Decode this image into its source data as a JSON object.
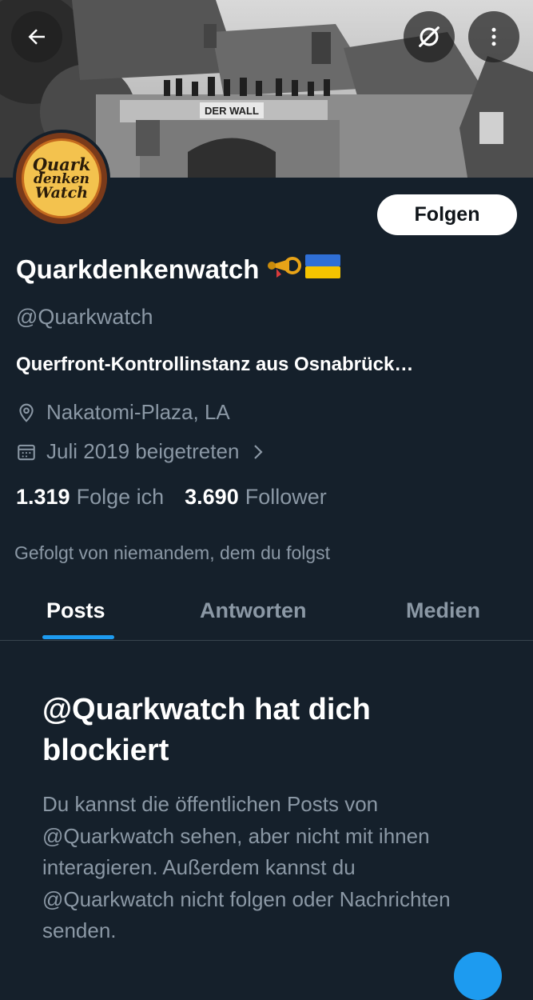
{
  "header": {
    "banner_signs": [
      "DER WALL"
    ],
    "back_icon": "arrow-left-icon",
    "hide_icon": "eye-slash-icon",
    "more_icon": "more-vertical-icon"
  },
  "avatar": {
    "lines": [
      "Quark",
      "denken",
      "Watch"
    ]
  },
  "profile": {
    "follow_label": "Folgen",
    "display_name": "Quarkdenkenwatch",
    "handle": "@Quarkwatch",
    "bio": "Querfront-Kontrollinstanz aus Osnabrück…",
    "location": "Nakatomi-Plaza, LA",
    "joined": "Juli 2019 beigetreten",
    "following_count": "1.319",
    "following_label": "Folge ich",
    "followers_count": "3.690",
    "followers_label": "Follower",
    "followed_by": "Gefolgt von niemandem, dem du folgst"
  },
  "tabs": [
    {
      "label": "Posts",
      "active": true
    },
    {
      "label": "Antworten",
      "active": false
    },
    {
      "label": "Medien",
      "active": false
    }
  ],
  "blocked": {
    "title": "@Quarkwatch hat dich blockiert",
    "text": "Du kannst die öffentlichen Posts von @Quarkwatch sehen, aber nicht mit ihnen interagieren. Außerdem kannst du @Quarkwatch nicht folgen oder Nachrichten senden."
  },
  "colors": {
    "background": "#15202b",
    "secondary_text": "#8b98a5",
    "accent": "#1d9bf0",
    "divider": "#38444d"
  }
}
